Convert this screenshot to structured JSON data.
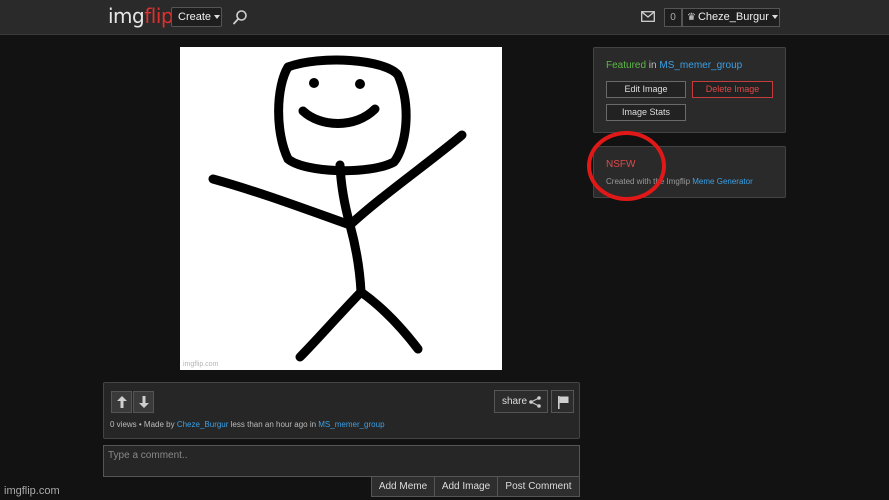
{
  "header": {
    "logo_part1": "img",
    "logo_part2": "flip",
    "create_label": "Create",
    "notification_count": "0",
    "username": "Cheze_Burgur",
    "icons": [
      "search-icon",
      "mail-icon",
      "crown-icon",
      "chevron-down-icon"
    ]
  },
  "meme": {
    "watermark": "imgflip.com"
  },
  "featured_panel": {
    "featured_label": "Featured",
    "featured_in": " in ",
    "stream_name": "MS_memer_group",
    "edit_image": "Edit Image",
    "delete_image": "Delete Image",
    "image_stats": "Image Stats"
  },
  "nsfw_panel": {
    "nsfw_label": "NSFW",
    "created_prefix": "Created with the Imgflip ",
    "created_link": "Meme Generator"
  },
  "info_bar": {
    "share_label": "share",
    "stats_prefix": "0 views • Made by ",
    "author": "Cheze_Burgur",
    "time_text": " less than an hour ago in ",
    "stream": "MS_memer_group"
  },
  "comment": {
    "placeholder": "Type a comment..",
    "add_meme": "Add Meme",
    "add_image": "Add Image",
    "post_comment": "Post Comment"
  },
  "footer": {
    "site_watermark": "imgflip.com"
  },
  "colors": {
    "background": "#121212",
    "header": "#2a2a2a",
    "accent_red": "#e04848",
    "link_blue": "#3aa0e6",
    "featured_green": "#5cba47",
    "annotation_circle": "#e01818"
  }
}
